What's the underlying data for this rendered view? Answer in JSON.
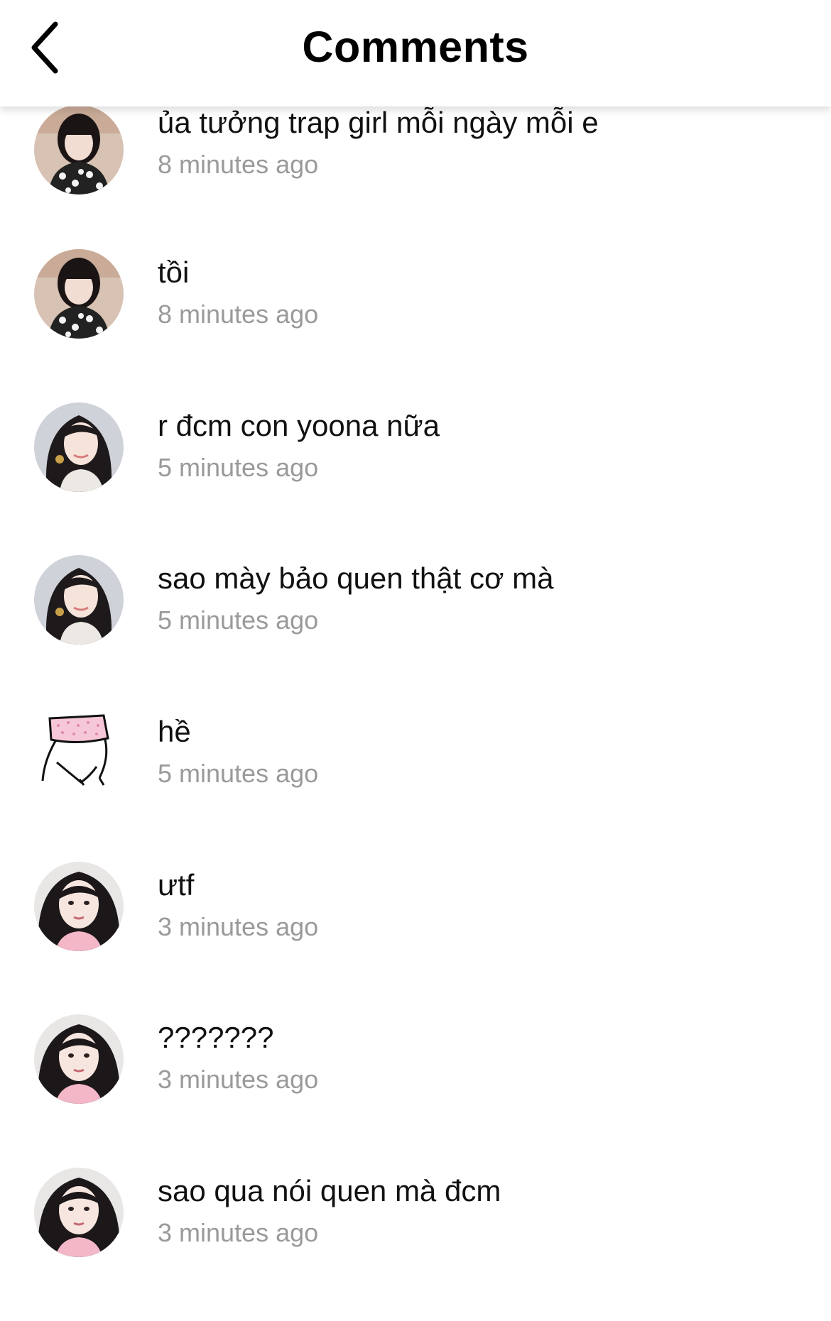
{
  "header": {
    "title": "Comments",
    "back_icon": "chevron-left-icon"
  },
  "comments": [
    {
      "text": " ủa tưởng trap girl mỗi ngày mỗi e",
      "time": "8 minutes ago",
      "avatar": "girl-patterned-top-avatar"
    },
    {
      "text": "tồi",
      "time": "8 minutes ago",
      "avatar": "girl-patterned-top-avatar"
    },
    {
      "text": "r đcm con yoona nữa",
      "time": "5 minutes ago",
      "avatar": "girl-dark-hair-earrings-avatar"
    },
    {
      "text": "sao mày bảo quen thật cơ mà",
      "time": "5 minutes ago",
      "avatar": "girl-dark-hair-earrings-avatar"
    },
    {
      "text": "hề",
      "time": "5 minutes ago",
      "avatar": "sketch-pink-hat-avatar"
    },
    {
      "text": "ưtf",
      "time": "3 minutes ago",
      "avatar": "girl-pink-top-avatar"
    },
    {
      "text": "???????",
      "time": "3 minutes ago",
      "avatar": "girl-pink-top-avatar"
    },
    {
      "text": "sao qua nói quen mà đcm",
      "time": "3 minutes ago",
      "avatar": "girl-pink-top-avatar"
    }
  ]
}
